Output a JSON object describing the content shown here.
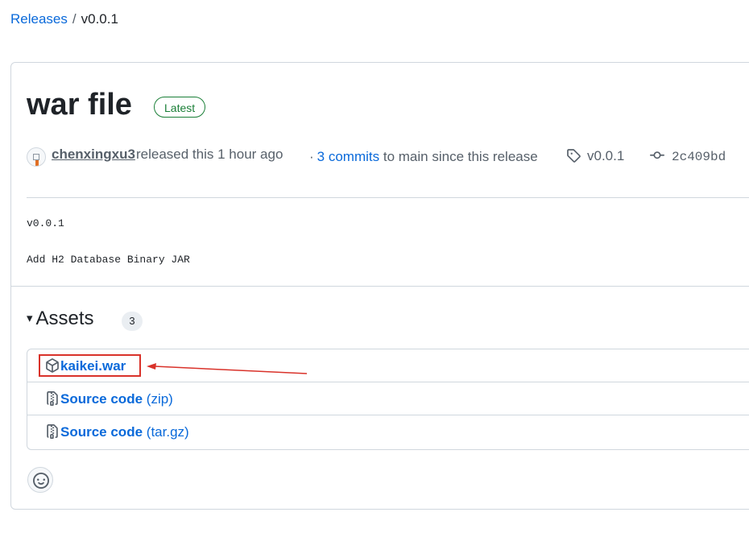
{
  "breadcrumb": {
    "releases_label": "Releases",
    "separator": "/",
    "current": "v0.0.1"
  },
  "release": {
    "title": "war file",
    "badge": "Latest",
    "author": "chenxingxu3",
    "released_text": "released this 1 hour ago",
    "commits_dot": "·",
    "commits_link": "3 commits",
    "commits_suffix": "to main since this release",
    "tag": "v0.0.1",
    "commit_sha": "2c409bd",
    "body_lines": [
      "v0.0.1",
      "Add H2 Database Binary JAR"
    ]
  },
  "assets": {
    "caret": "▾",
    "label": "Assets",
    "count": "3",
    "items": [
      {
        "name": "kaikei.war",
        "suffix": "",
        "icon": "package-icon"
      },
      {
        "name": "Source code",
        "suffix": "(zip)",
        "icon": "file-zip-icon"
      },
      {
        "name": "Source code",
        "suffix": "(tar.gz)",
        "icon": "file-zip-icon"
      }
    ]
  },
  "colors": {
    "link": "#0969da",
    "latest_badge": "#1a7f37",
    "annotation": "#d9322a"
  }
}
